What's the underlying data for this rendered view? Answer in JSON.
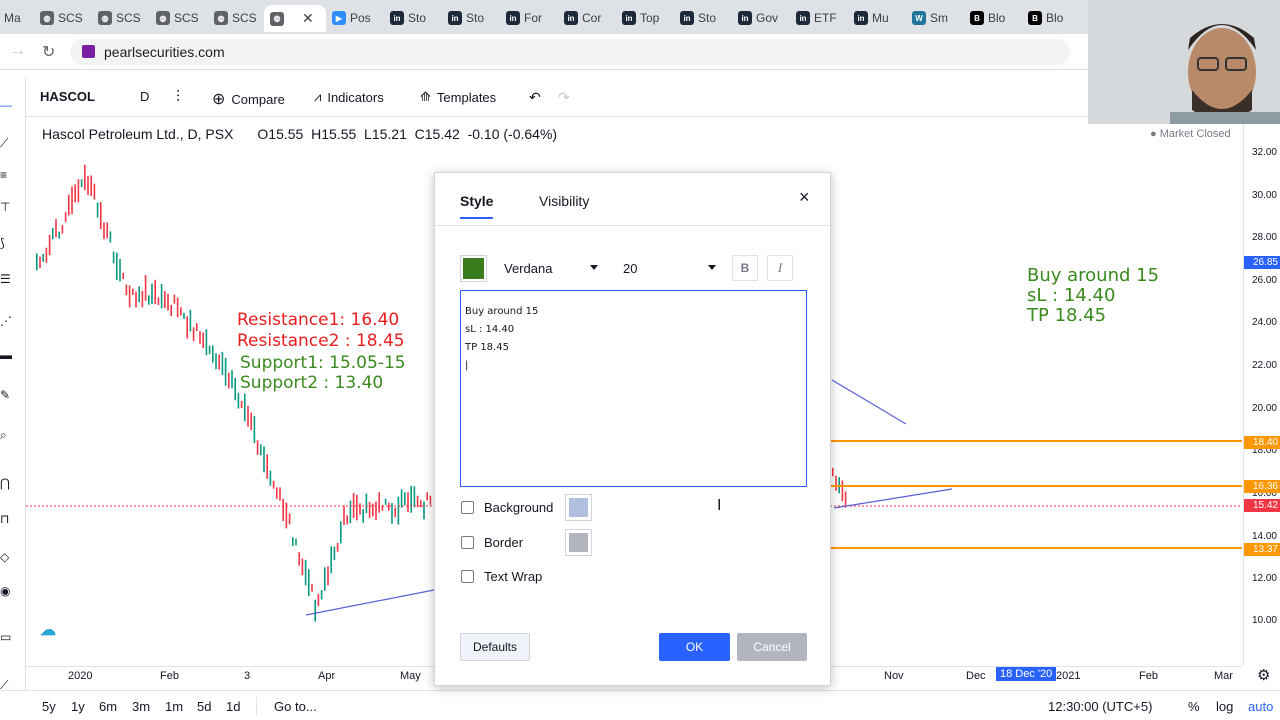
{
  "browser": {
    "tabs": [
      "Ma",
      "SCS",
      "SCS",
      "SCS",
      "SCS",
      "",
      "Pos",
      "Sto",
      "Sto",
      "For",
      "Cor",
      "Top",
      "Sto",
      "Gov",
      "ETF",
      "Mu",
      "Sm",
      "Blo",
      "Blo"
    ],
    "url": "pearlsecurities.com"
  },
  "toolbar": {
    "symbol": "HASCOL",
    "interval": "D",
    "compare": "Compare",
    "indicators": "Indicators",
    "templates": "Templates"
  },
  "legend": {
    "title": "Hascol Petroleum Ltd., D, PSX",
    "ohlc": "O15.55  H15.55  L15.21  C15.42  -0.10 (-0.64%)"
  },
  "market_status": "Market Closed",
  "yaxis": {
    "labels": [
      "32.00",
      "30.00",
      "28.00",
      "26.00",
      "24.00",
      "22.00",
      "20.00",
      "18.00",
      "16.00",
      "14.00",
      "12.00",
      "10.00"
    ],
    "tags": [
      {
        "text": "26.85",
        "color": "#2962ff"
      },
      {
        "text": "18.40",
        "color": "#ff9800"
      },
      {
        "text": "16.36",
        "color": "#ff9800"
      },
      {
        "text": "15.42",
        "color": "#f23645"
      },
      {
        "text": "13.37",
        "color": "#ff9800"
      }
    ]
  },
  "xaxis": {
    "labels": [
      "2020",
      "Feb",
      "3",
      "Apr",
      "May",
      "Nov",
      "Dec",
      "2021",
      "Feb",
      "Mar"
    ],
    "cursor_date": "18 Dec '20"
  },
  "annotations": {
    "resistance1": "Resistance1: 16.40",
    "resistance2": "Resistance2 : 18.45",
    "support1": "Support1: 15.05-15",
    "support2": "Support2 : 13.40",
    "note_line1": "Buy around 15",
    "note_line2": "sL : 14.40",
    "note_line3": "TP 18.45"
  },
  "timeframes": [
    "5y",
    "1y",
    "6m",
    "3m",
    "1m",
    "5d",
    "1d"
  ],
  "goto": "Go to...",
  "clock": "12:30:00 (UTC+5)",
  "bottom_right": {
    "percent": "%",
    "log": "log",
    "auto": "auto"
  },
  "dialog": {
    "tab_style": "Style",
    "tab_visibility": "Visibility",
    "color": "#3a7d1f",
    "font": "Verdana",
    "size": "20",
    "bold": "B",
    "italic": "I",
    "text_value": "Buy around 15\nsL : 14.40\nTP 18.45\n|",
    "background_label": "Background",
    "border_label": "Border",
    "wrap_label": "Text Wrap",
    "background_color": "#b2c0e0",
    "border_color": "#b2b5be",
    "defaults": "Defaults",
    "ok": "OK",
    "cancel": "Cancel"
  },
  "colors": {
    "accent": "#2962ff",
    "resistance": "#e91e1e",
    "support": "#3a8a1f",
    "level_line": "#ff9800"
  }
}
